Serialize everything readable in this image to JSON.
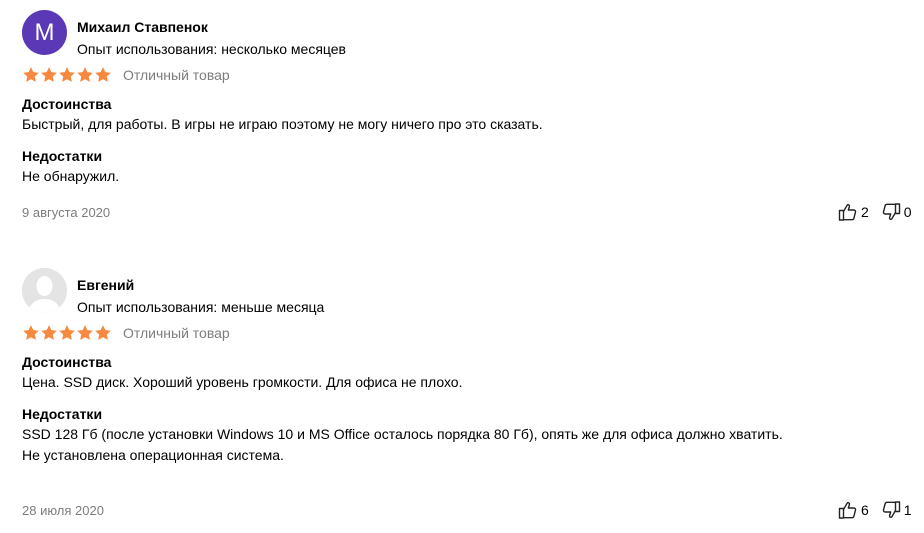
{
  "reviews": [
    {
      "avatar_letter": "М",
      "author": "Михаил Ставпенок",
      "experience": "Опыт использования: несколько месяцев",
      "rating": 5,
      "verdict": "Отличный товар",
      "pros_title": "Достоинства",
      "pros_text": "Быстрый, для работы. В игры не играю поэтому не могу ничего про это сказать.",
      "cons_title": "Недостатки",
      "cons_lines": [
        "Не обнаружил."
      ],
      "date": "9 августа 2020",
      "likes": "2",
      "dislikes": "0"
    },
    {
      "author": "Евгений",
      "experience": "Опыт использования: меньше месяца",
      "rating": 5,
      "verdict": "Отличный товар",
      "pros_title": "Достоинства",
      "pros_text": "Цена. SSD диск. Хороший уровень громкости. Для офиса не плохо.",
      "cons_title": "Недостатки",
      "cons_lines": [
        "SSD 128 Гб (после установки Windows 10 и MS Office осталось порядка 80 Гб), опять же для офиса должно хватить.",
        "Не установлена операционная система."
      ],
      "date": "28 июля 2020",
      "likes": "6",
      "dislikes": "1"
    }
  ],
  "colors": {
    "star": "#f6893e",
    "avatar_purple": "#5b38b5",
    "muted_text": "#7d7d7d"
  },
  "icons": [
    "star-icon",
    "thumbs-up-icon",
    "thumbs-down-icon",
    "user-silhouette-icon"
  ]
}
